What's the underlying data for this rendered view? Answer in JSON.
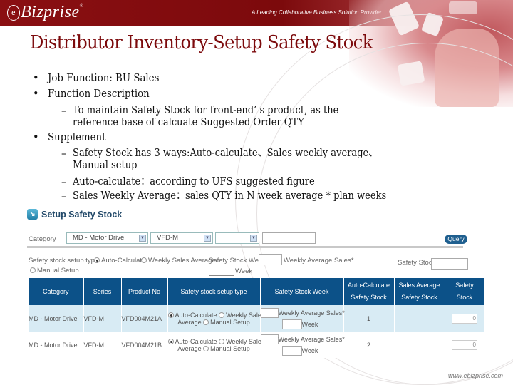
{
  "header": {
    "logo": "Bizprise",
    "logo_mark": "e",
    "logo_registered": "®",
    "tagline": "A Leading Collaborative Business Solution Provider"
  },
  "slide": {
    "title": "Distributor Inventory-Setup Safety Stock",
    "bullets": [
      {
        "text": "Job Function: BU Sales"
      },
      {
        "text": "Function Description",
        "sub": [
          "To maintain Safety Stock for front-end’ s product, as the",
          "reference base of calcuate Suggested Order QTY"
        ]
      },
      {
        "text": "Supplement",
        "sub": [
          "Safety Stock has 3 ways:Auto-calculate、Sales weekly average、",
          "Manual setup",
          "Auto-calculate：according to UFS suggested figure",
          "Sales Weekly Average：sales QTY in N week average * plan weeks"
        ]
      }
    ],
    "bullet_glyph": "•",
    "dash_glyph": "–",
    "footer_url": "www.ebizprise.com"
  },
  "app": {
    "title": "Setup Safety Stock",
    "filters": {
      "category_label": "Category",
      "category_value": "MD - Motor Drive",
      "series_value": "VFD-M",
      "third_value": "",
      "text_value": "",
      "query_label": "Query"
    },
    "setup": {
      "type_label": "Safety stock setup type",
      "options": [
        "Auto-Calculate",
        "Weekly Sales Average",
        "Manual Setup"
      ],
      "selected": "Auto-Calculate",
      "week_label": "Safety Stock Week",
      "weekly_avg_label": "Weekly Average Sales*",
      "week_unit": "Week",
      "safety_stock_label": "Safety Stock"
    },
    "table": {
      "headers": [
        "Category",
        "Series",
        "Product No",
        "Safety stock setup type",
        "Safety Stock Week",
        "Auto-Calculate\nSafety Stock",
        "Sales Average\nSafety Stock",
        "Safety\nStock"
      ],
      "header_lines": [
        [
          "Category"
        ],
        [
          "Series"
        ],
        [
          "Product No"
        ],
        [
          "Safety stock setup type"
        ],
        [
          "Safety Stock Week"
        ],
        [
          "Auto-Calculate",
          "Safety Stock"
        ],
        [
          "Sales Average",
          "Safety Stock"
        ],
        [
          "Safety",
          "Stock"
        ]
      ],
      "radio_labels": {
        "auto": "Auto-Calculate",
        "weekly_a": "Weekly Sales",
        "weekly_b": "Average",
        "manual": "Manual Setup"
      },
      "rows": [
        {
          "category": "MD - Motor Drive",
          "series": "VFD-M",
          "product_no": "VFD004M21A",
          "setup_type": "Auto-Calculate",
          "weekly_avg_label": "Weekly Average Sales*",
          "week_unit": "Week",
          "auto_calc_ss": "1",
          "sales_avg_ss": "",
          "safety_stock": "0"
        },
        {
          "category": "MD - Motor Drive",
          "series": "VFD-M",
          "product_no": "VFD004M21B",
          "setup_type": "Auto-Calculate",
          "weekly_avg_label": "Weekly Average Sales*",
          "week_unit": "Week",
          "auto_calc_ss": "2",
          "sales_avg_ss": "",
          "safety_stock": "0"
        }
      ]
    }
  }
}
